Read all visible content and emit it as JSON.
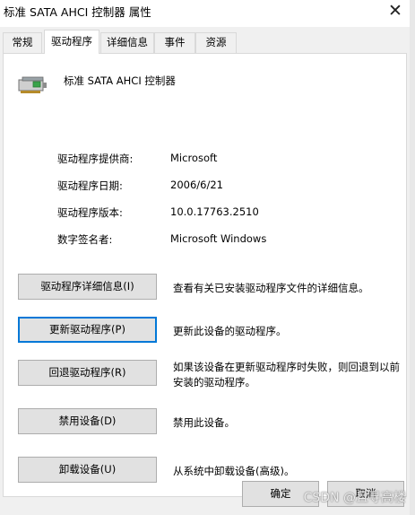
{
  "window": {
    "title": "标准 SATA AHCI 控制器 属性",
    "close_glyph": "✕"
  },
  "tabs": [
    {
      "label": "常规"
    },
    {
      "label": "驱动程序",
      "active": true
    },
    {
      "label": "详细信息"
    },
    {
      "label": "事件"
    },
    {
      "label": "资源"
    }
  ],
  "device": {
    "icon": "storage-controller-icon",
    "name": "标准 SATA AHCI 控制器"
  },
  "info": [
    {
      "label": "驱动程序提供商:",
      "value": "Microsoft"
    },
    {
      "label": "驱动程序日期:",
      "value": "2006/6/21"
    },
    {
      "label": "驱动程序版本:",
      "value": "10.0.17763.2510"
    },
    {
      "label": "数字签名者:",
      "value": "Microsoft Windows"
    }
  ],
  "actions": [
    {
      "button": "驱动程序详细信息(I)",
      "desc": "查看有关已安装驱动程序文件的详细信息。"
    },
    {
      "button": "更新驱动程序(P)",
      "desc": "更新此设备的驱动程序。"
    },
    {
      "button": "回退驱动程序(R)",
      "desc": "如果该设备在更新驱动程序时失败，则回退到以前安装的驱动程序。"
    },
    {
      "button": "禁用设备(D)",
      "desc": "禁用此设备。"
    },
    {
      "button": "卸载设备(U)",
      "desc": "从系统中卸载设备(高级)。"
    }
  ],
  "footer": {
    "ok_label": "确定",
    "cancel_label": "取消"
  },
  "watermark": "CSDN @且寻高楼"
}
